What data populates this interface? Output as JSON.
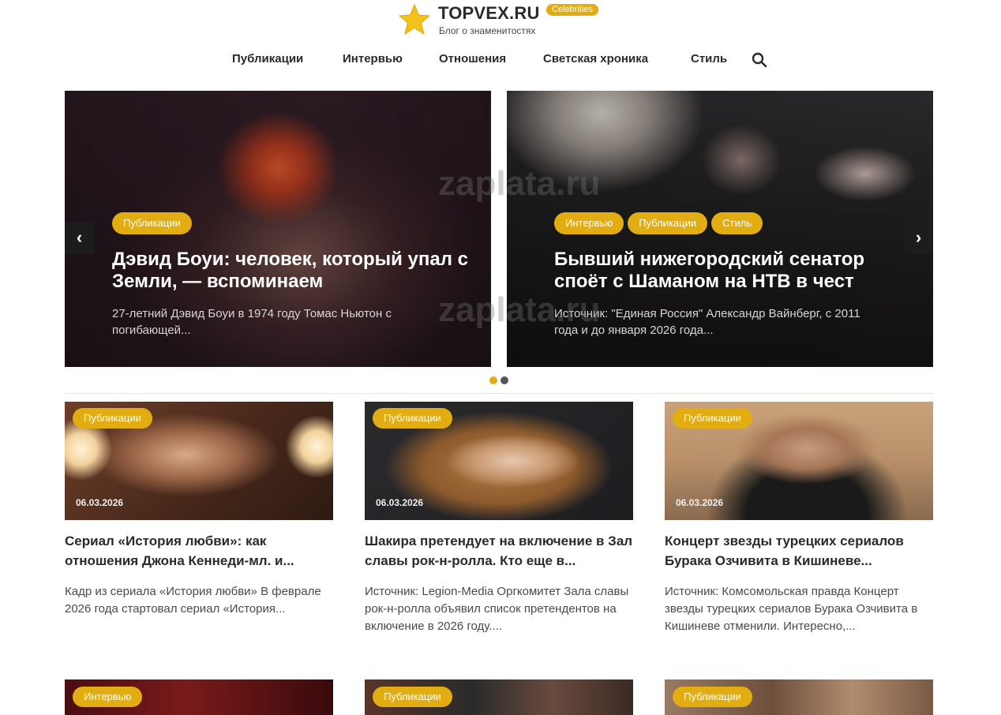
{
  "site": {
    "name": "TOPVEX.RU",
    "badge": "Celebrities",
    "tagline": "Блог о знаменитостях"
  },
  "nav": {
    "items": [
      "Публикации",
      "Интервью",
      "Отношения",
      "Светская хроника",
      "Стиль"
    ],
    "search_icon": "search-icon"
  },
  "slider": {
    "prev_label": "‹",
    "next_label": "›",
    "slides": [
      {
        "tags": [
          "Публикации"
        ],
        "title": "Дэвид Боуи: человек, который упал с Земли, — вспоминаем",
        "excerpt": "27-летний Дэвид Боуи в 1974 году Томас Ньютон с погибающей..."
      },
      {
        "tags": [
          "Интервью",
          "Публикации",
          "Стиль"
        ],
        "title": "Бывший нижегородский сенатор споёт с Шаманом на НТВ в чест",
        "excerpt": "Источник: \"Единая Россия\" Александр Вайнберг, с 2011 года и до января 2026 года..."
      }
    ],
    "active_dot": 0,
    "dot_count": 2
  },
  "cards": [
    {
      "tag": "Публикации",
      "date": "06.03.2026",
      "title": "Сериал «История любви»: как отношения Джона Кеннеди-мл. и...",
      "excerpt": "Кадр из сериала «История любви» В феврале 2026 года стартовал сериал «История..."
    },
    {
      "tag": "Публикации",
      "date": "06.03.2026",
      "title": "Шакира претендует на включение в Зал славы рок-н-ролла. Кто еще в...",
      "excerpt": "Источник: Legion-Media Оргкомитет Зала славы рок-н-ролла объявил список претендентов на включение в 2026 году...."
    },
    {
      "tag": "Публикации",
      "date": "06.03.2026",
      "title": "Концерт звезды турецких сериалов Бурака Озчивита в Кишиневе...",
      "excerpt": "Источник: Комсомольская правда Концерт звезды турецких сериалов Бурака Озчивита в Кишиневе отменили. Интересно,..."
    }
  ],
  "cards_row2": [
    {
      "tag": "Интервью"
    },
    {
      "tag": "Публикации"
    },
    {
      "tag": "Публикации"
    }
  ],
  "watermark": "zaplata.ru",
  "colors": {
    "accent": "#e2ad12",
    "dot_inactive": "#555555",
    "text_dark": "#2a2a2a"
  }
}
